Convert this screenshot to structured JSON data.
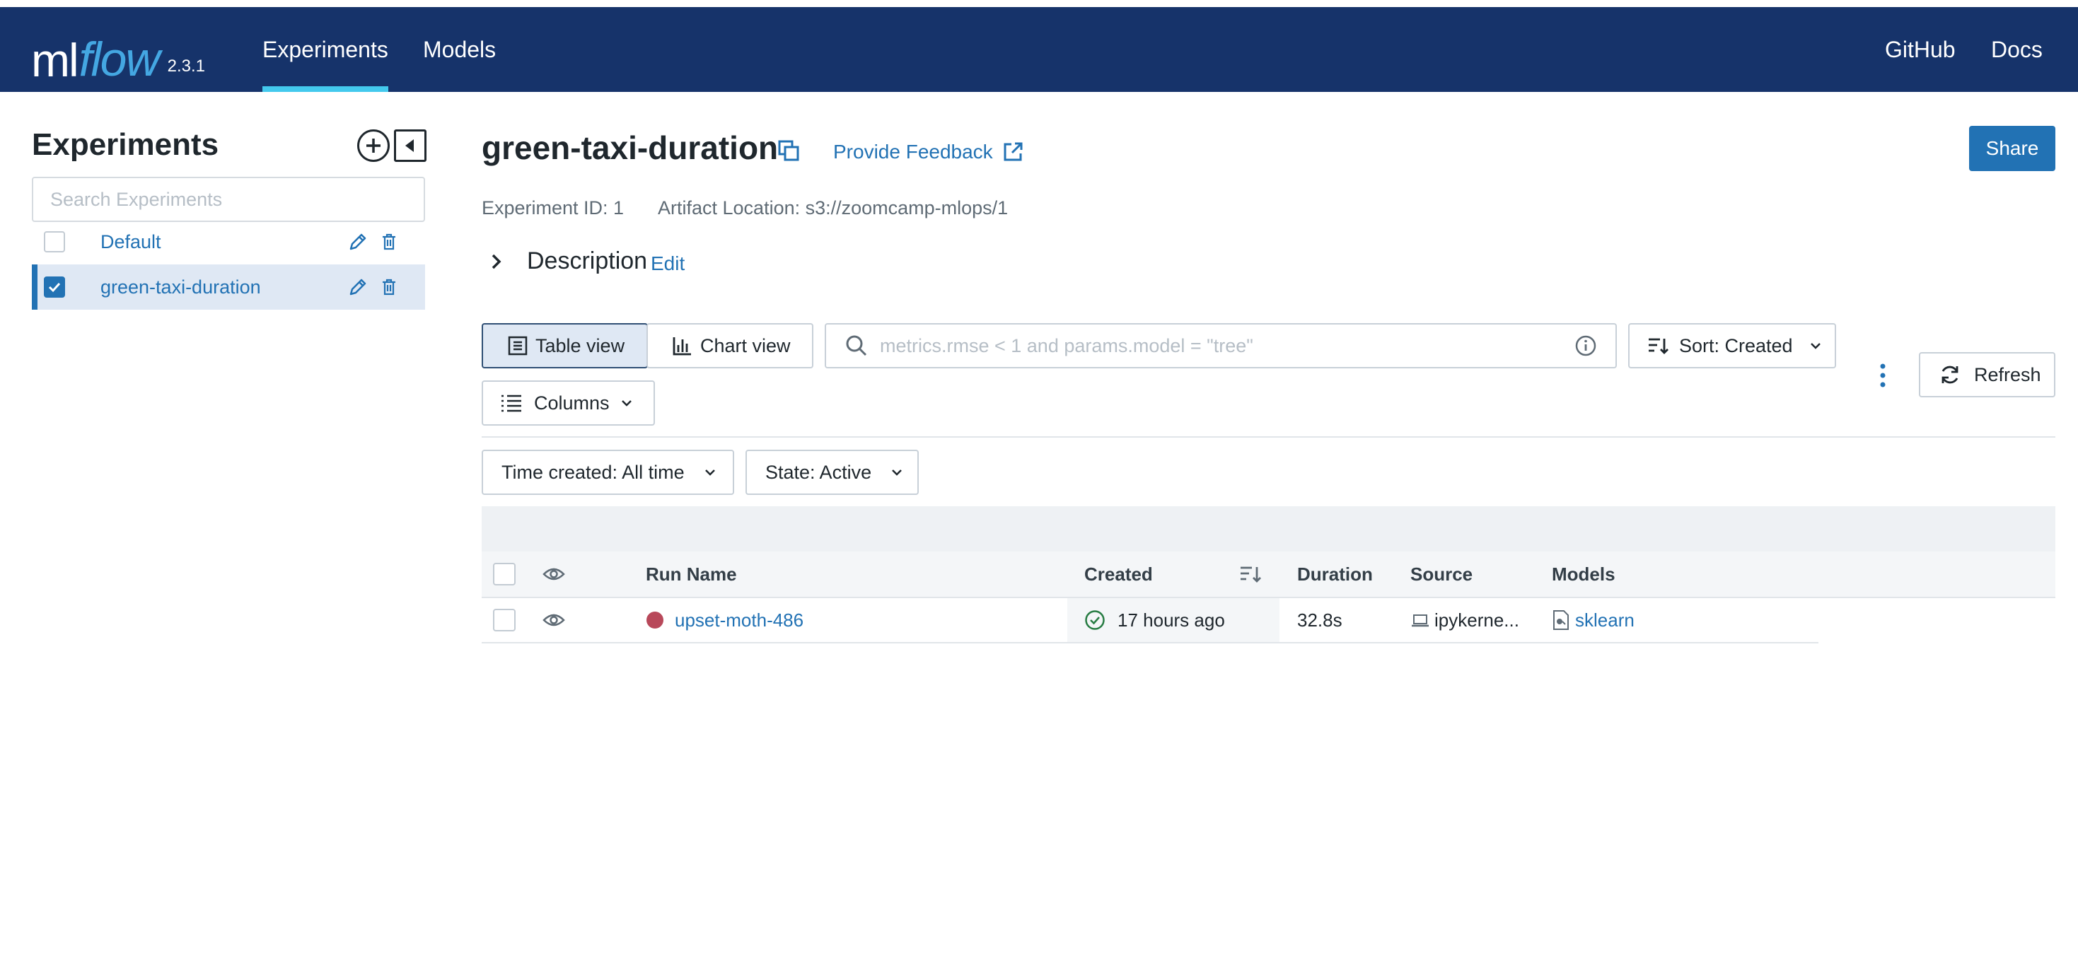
{
  "app": {
    "logo_ml": "ml",
    "logo_flow": "flow",
    "version": "2.3.1",
    "nav": [
      {
        "label": "Experiments",
        "active": true
      },
      {
        "label": "Models",
        "active": false
      }
    ],
    "nav_right": [
      {
        "label": "GitHub"
      },
      {
        "label": "Docs"
      }
    ],
    "colors": {
      "topbar": "#16336a",
      "accent": "#2272b4",
      "nav_active": "#43c9ed"
    }
  },
  "sidebar": {
    "title": "Experiments",
    "search_placeholder": "Search Experiments",
    "experiments": [
      {
        "name": "Default",
        "selected": false
      },
      {
        "name": "green-taxi-duration",
        "selected": true
      }
    ]
  },
  "experiment": {
    "title": "green-taxi-duration",
    "feedback_label": "Provide Feedback",
    "share_label": "Share",
    "id_label": "Experiment ID: 1",
    "artifact_label": "Artifact Location: s3://zoomcamp-mlops/1",
    "description_label": "Description",
    "edit_label": "Edit"
  },
  "controls": {
    "table_view": "Table view",
    "chart_view": "Chart view",
    "search_placeholder": "metrics.rmse < 1 and params.model = \"tree\"",
    "sort_label": "Sort: Created",
    "refresh_label": "Refresh",
    "columns_label": "Columns",
    "time_filter": "Time created: All time",
    "state_filter": "State: Active"
  },
  "table": {
    "columns": [
      "Run Name",
      "Created",
      "Duration",
      "Source",
      "Models"
    ],
    "rows": [
      {
        "run_name": "upset-moth-486",
        "created": "17 hours ago",
        "duration": "32.8s",
        "source": "ipykerne...",
        "model": "sklearn"
      }
    ]
  }
}
